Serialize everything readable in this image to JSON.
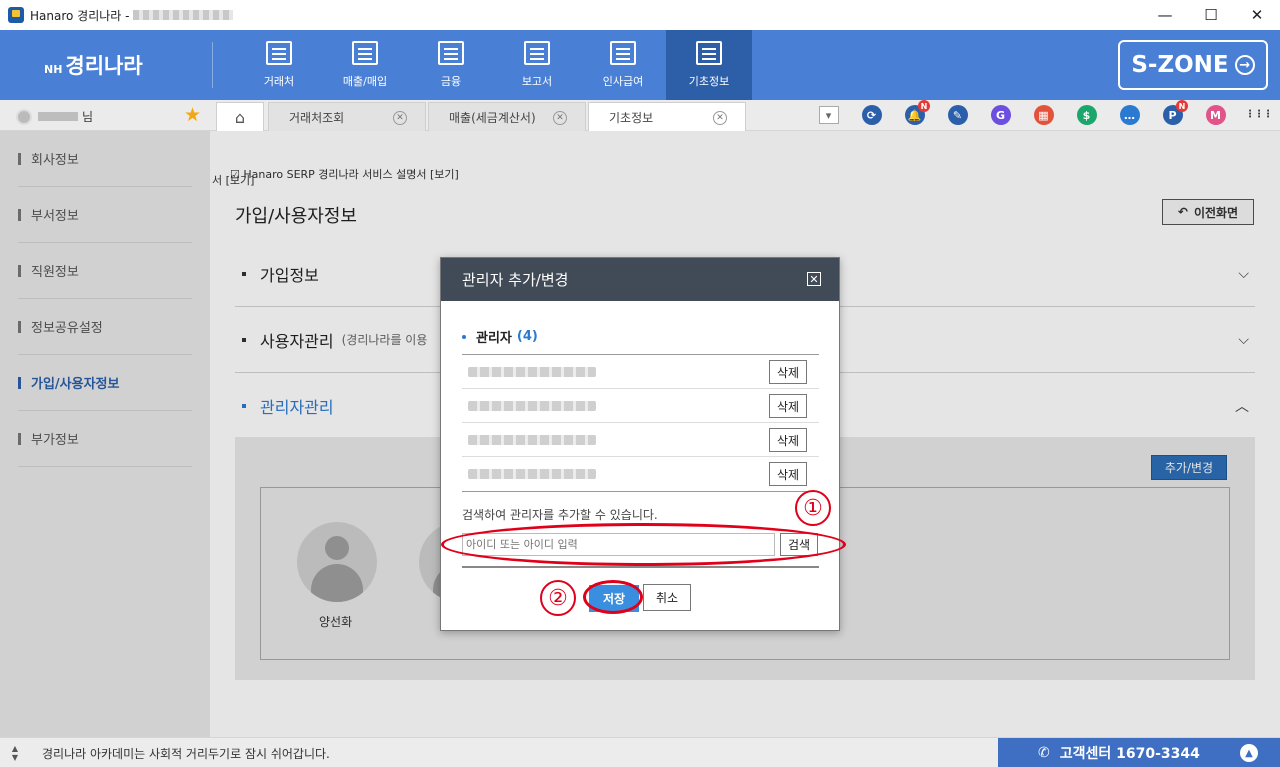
{
  "window": {
    "title": "Hanaro 경리나라 -",
    "minimize": "—",
    "maximize": "☐",
    "close": "✕"
  },
  "brand": {
    "prefix": "NH",
    "name": "경리나라"
  },
  "topmenu": [
    {
      "label": "거래처",
      "icon": "building-icon"
    },
    {
      "label": "매출/매입",
      "icon": "exchange-icon"
    },
    {
      "label": "금융",
      "icon": "card-coins-icon"
    },
    {
      "label": "보고서",
      "icon": "bar-chart-icon"
    },
    {
      "label": "인사급여",
      "icon": "id-card-icon"
    },
    {
      "label": "기초정보",
      "icon": "settings-window-icon",
      "active": true
    }
  ],
  "szone": {
    "label": "S-ZONE",
    "arrow": "→"
  },
  "user": {
    "suffix": "님"
  },
  "tabs": [
    {
      "label": "거래처조회"
    },
    {
      "label": "매출(세금계산서)"
    },
    {
      "label": "기초정보",
      "active": true
    }
  ],
  "toolbar_icons": [
    {
      "name": "dropdown-icon",
      "glyph": "▾",
      "color": "#ffffff"
    },
    {
      "name": "sync-icon",
      "glyph": "⟳",
      "color": "#2b5faa"
    },
    {
      "name": "bell-icon",
      "glyph": "🔔",
      "color": "#2b5faa",
      "badge": "N"
    },
    {
      "name": "edit-icon",
      "glyph": "✎",
      "color": "#2b5faa"
    },
    {
      "name": "g-icon",
      "glyph": "G",
      "color": "#6c4ee0"
    },
    {
      "name": "calendar-icon",
      "glyph": "▦",
      "color": "#e2533c"
    },
    {
      "name": "dollar-icon",
      "glyph": "$",
      "color": "#1ba66b"
    },
    {
      "name": "chat-icon",
      "glyph": "…",
      "color": "#2b7ad1"
    },
    {
      "name": "p-icon",
      "glyph": "P",
      "color": "#2b5faa",
      "badge": "N"
    },
    {
      "name": "memo-icon",
      "glyph": "M",
      "color": "#e0548a"
    },
    {
      "name": "grid-icon",
      "glyph": "⋮⋮⋮",
      "color": "#333333"
    }
  ],
  "sidebar": [
    {
      "label": "회사정보"
    },
    {
      "label": "부서정보"
    },
    {
      "label": "직원정보"
    },
    {
      "label": "정보공유설정"
    },
    {
      "label": "가입/사용자정보",
      "active": true
    },
    {
      "label": "부가정보"
    }
  ],
  "page": {
    "crumb": "☑ Hanaro SERP 경리나라 서비스 설명서 [보기]",
    "crumb_overlap": "서 [보기]",
    "title": "가입/사용자정보",
    "back_label": "이전화면",
    "sections": [
      {
        "label": "가입정보",
        "chevron": "⌵"
      },
      {
        "label": "사용자관리",
        "sub": "(경리나라를 이용",
        "chevron": "⌵"
      },
      {
        "label": "관리자관리",
        "chevron": "︿"
      }
    ],
    "add_change_label": "추가/변경",
    "admins": [
      {
        "name": "양선화"
      }
    ]
  },
  "statusbar": {
    "text": "경리나라 아카데미는 사회적 거리두기로 잠시 쉬어갑니다.",
    "support": "고객센터 1670-3344"
  },
  "modal": {
    "title": "관리자 추가/변경",
    "list_label": "관리자",
    "list_count": "(4)",
    "delete_label": "삭제",
    "rows": 4,
    "hint": "검색하여 관리자를 추가할 수 있습니다.",
    "search_placeholder": "아이디 또는 아이디 입력",
    "search_label": "검색",
    "save_label": "저장",
    "cancel_label": "취소"
  },
  "annotations": [
    {
      "label": "①"
    },
    {
      "label": "②"
    }
  ]
}
